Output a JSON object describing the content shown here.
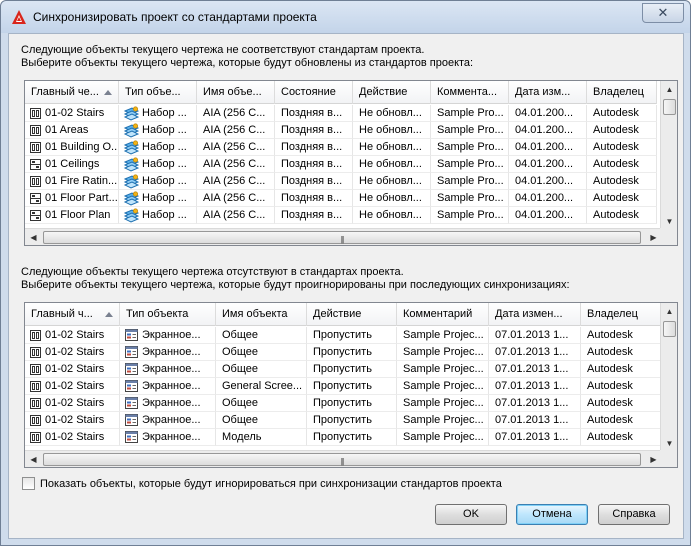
{
  "window": {
    "title": "Синхронизировать проект со стандартами проекта",
    "close_glyph": "✕"
  },
  "section1": {
    "desc_line1": "Следующие объекты текущего чертежа не соответствуют стандартам проекта.",
    "desc_line2": "Выберите объекты текущего чертежа, которые будут обновлены из стандартов проекта:",
    "columns": [
      "Главный че...",
      "Тип объе...",
      "Имя объе...",
      "Состояние",
      "Действие",
      "Коммента...",
      "Дата изм...",
      "Владелец"
    ],
    "rows": [
      [
        "01-02 Stairs",
        "Набор ...",
        "AIA (256 C...",
        "Поздняя в...",
        "Не обновл...",
        "Sample Pro...",
        "04.01.200...",
        "Autodesk"
      ],
      [
        "01 Areas",
        "Набор ...",
        "AIA (256 C...",
        "Поздняя в...",
        "Не обновл...",
        "Sample Pro...",
        "04.01.200...",
        "Autodesk"
      ],
      [
        "01 Building O...",
        "Набор ...",
        "AIA (256 C...",
        "Поздняя в...",
        "Не обновл...",
        "Sample Pro...",
        "04.01.200...",
        "Autodesk"
      ],
      [
        "01 Ceilings",
        "Набор ...",
        "AIA (256 C...",
        "Поздняя в...",
        "Не обновл...",
        "Sample Pro...",
        "04.01.200...",
        "Autodesk"
      ],
      [
        "01 Fire Ratin...",
        "Набор ...",
        "AIA (256 C...",
        "Поздняя в...",
        "Не обновл...",
        "Sample Pro...",
        "04.01.200...",
        "Autodesk"
      ],
      [
        "01 Floor Part...",
        "Набор ...",
        "AIA (256 C...",
        "Поздняя в...",
        "Не обновл...",
        "Sample Pro...",
        "04.01.200...",
        "Autodesk"
      ],
      [
        "01 Floor Plan",
        "Набор ...",
        "AIA (256 C...",
        "Поздняя в...",
        "Не обновл...",
        "Sample Pro...",
        "04.01.200...",
        "Autodesk"
      ]
    ],
    "row_icons": [
      "building-icon",
      "building-icon",
      "building-icon",
      "ceiling-icon",
      "building-icon",
      "ceiling-icon",
      "ceiling-icon"
    ]
  },
  "section2": {
    "desc_line1": "Следующие объекты текущего чертежа отсутствуют в стандартах проекта.",
    "desc_line2": "Выберите объекты текущего чертежа, которые будут проигнорированы при последующих синхронизациях:",
    "columns": [
      "Главный ч...",
      "Тип объекта",
      "Имя объекта",
      "Действие",
      "Комментарий",
      "Дата измен...",
      "Владелец"
    ],
    "rows": [
      [
        "01-02 Stairs",
        "Экранное...",
        "Общее",
        "Пропустить",
        "Sample Projec...",
        "07.01.2013 1...",
        "Autodesk"
      ],
      [
        "01-02 Stairs",
        "Экранное...",
        "Общее",
        "Пропустить",
        "Sample Projec...",
        "07.01.2013 1...",
        "Autodesk"
      ],
      [
        "01-02 Stairs",
        "Экранное...",
        "Общее",
        "Пропустить",
        "Sample Projec...",
        "07.01.2013 1...",
        "Autodesk"
      ],
      [
        "01-02 Stairs",
        "Экранное...",
        "General Scree...",
        "Пропустить",
        "Sample Projec...",
        "07.01.2013 1...",
        "Autodesk"
      ],
      [
        "01-02 Stairs",
        "Экранное...",
        "Общее",
        "Пропустить",
        "Sample Projec...",
        "07.01.2013 1...",
        "Autodesk"
      ],
      [
        "01-02 Stairs",
        "Экранное...",
        "Общее",
        "Пропустить",
        "Sample Projec...",
        "07.01.2013 1...",
        "Autodesk"
      ],
      [
        "01-02 Stairs",
        "Экранное...",
        "Модель",
        "Пропустить",
        "Sample Projec...",
        "07.01.2013 1...",
        "Autodesk"
      ]
    ]
  },
  "checkbox_label": "Показать объекты, которые будут игнорироваться при синхронизации стандартов проекта",
  "buttons": {
    "ok": "OK",
    "cancel": "Отмена",
    "help": "Справка"
  },
  "scroll_glyphs": {
    "up": "▲",
    "down": "▼",
    "left": "◀",
    "right": "▶",
    "grip": "|||"
  },
  "colors": {
    "accent": "#3c7fb1",
    "title_bar": "#c3d4e9",
    "app_icon": "#d9261c"
  }
}
